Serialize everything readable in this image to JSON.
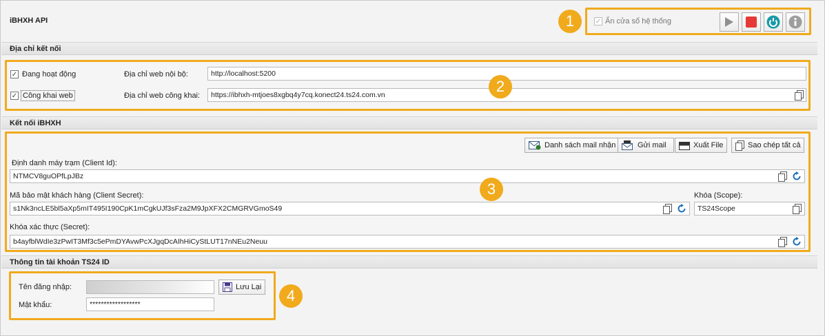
{
  "app": {
    "title": "iBHXH API"
  },
  "toolbar": {
    "hide_window_label": "Ẩn cửa sổ hệ thống",
    "hide_window_checked": true,
    "badge": "1"
  },
  "connection": {
    "section_title": "Địa chỉ kết nối",
    "active_label": "Đang hoạt động",
    "public_label": "Công khai web",
    "local_url_label": "Địa chỉ web nội bộ:",
    "local_url_value": "http://localhost:5200",
    "public_url_label": "Địa chỉ web công khai:",
    "public_url_value": "https://ibhxh-mtjoes8xgbq4y7cq.konect24.ts24.com.vn",
    "badge": "2"
  },
  "ibhxh": {
    "section_title": "Kết nối iBHXH",
    "buttons": {
      "mail_list": "Danh sách mail nhận",
      "send_mail": "Gửi mail",
      "export_file": "Xuất File",
      "copy_all": "Sao chép tất cả"
    },
    "client_id_label": "Định danh máy trạm (Client Id):",
    "client_id_value": "NTMCV8guOPfLpJBz",
    "client_secret_label": "Mã bảo mật khách hàng (Client Secret):",
    "client_secret_value": "s1Nk3ncLE5bl5aXp5mIT495I190CpK1mCgkUJf3sFza2M9JpXFX2CMGRVGmoS49",
    "scope_label": "Khóa (Scope):",
    "scope_value": "TS24Scope",
    "secret_label": "Khóa xác thực (Secret):",
    "secret_value": "b4ayfblWdIe3zPwIT3Mf3c5ePmDYAvwPcXJgqDcAIhHiCyStLUT17nNEu2Neuu",
    "badge": "3"
  },
  "account": {
    "section_title": "Thông tin tài khoản TS24 ID",
    "username_label": "Tên đăng nhập:",
    "username_value": "",
    "password_label": "Mật khẩu:",
    "password_value": "******************",
    "save_label": "Lưu Lại",
    "badge": "4"
  },
  "colors": {
    "accent": "#f0aa1c",
    "stop": "#e53935",
    "refresh": "#1a9aa8",
    "info": "#9e9e9e"
  }
}
